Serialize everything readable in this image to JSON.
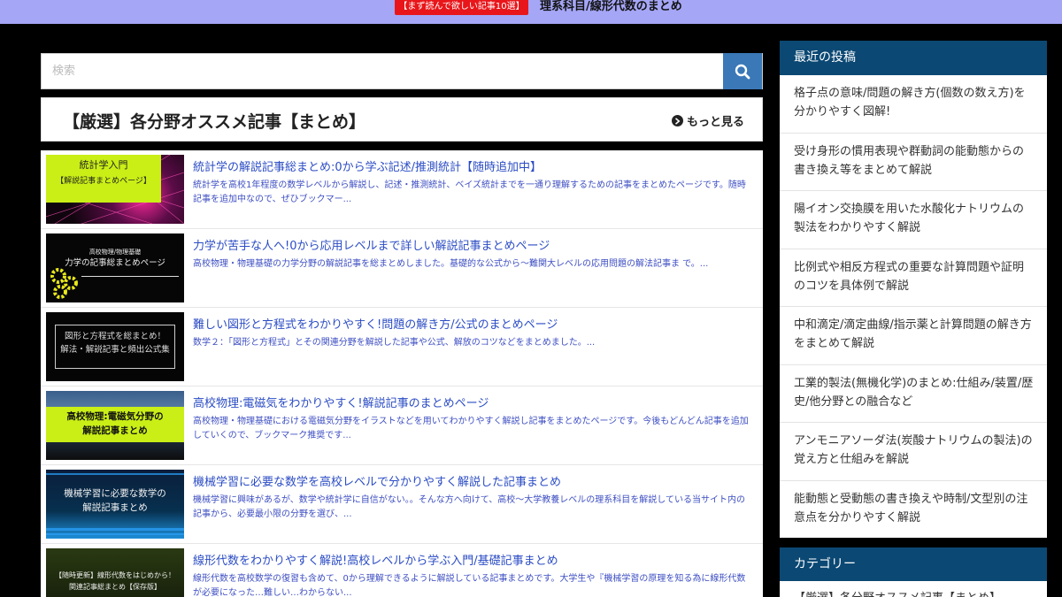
{
  "topbar": {
    "badge": "【まず読んで欲しい記事10選】",
    "link": "理系科目/線形代数のまとめ"
  },
  "search": {
    "placeholder": "検索",
    "value": ""
  },
  "featured": {
    "title": "【厳選】各分野オススメ記事【まとめ】",
    "more": "もっと見る"
  },
  "articles": [
    {
      "title": "統計学の解説記事総まとめ:0から学ぶ記述/推測統計【随時追加中】",
      "excerpt": "統計学を高校1年程度の数学レベルから解説し、記述・推測統計、ベイズ統計までを一通り理解するための記事をまとめたページです。随時記事を追加中なので、ぜひブックマー...",
      "thumb_lines": [
        "統計学入門",
        "【解説記事まとめページ】"
      ]
    },
    {
      "title": "力学が苦手な人へ!0から応用レベルまで詳しい解説記事まとめページ",
      "excerpt": "高校物理・物理基礎の力学分野の解説記事を総まとめしました。基礎的な公式から〜難関大レベルの応用問題の解法記事ま で。...",
      "thumb_lines": [
        "高校物理/物理基礎",
        "力学の記事総まとめページ"
      ]
    },
    {
      "title": "難しい図形と方程式をわかりやすく!問題の解き方/公式のまとめページ",
      "excerpt": "数学２：「図形と方程式」とその関連分野を解説した記事や公式、解放のコツなどをまとめました。...",
      "thumb_lines": [
        "図形と方程式を総まとめ！",
        "解法・解説記事と頻出公式集"
      ]
    },
    {
      "title": "高校物理:電磁気をわかりやすく!解説記事のまとめページ",
      "excerpt": "高校物理・物理基礎における電磁気分野をイラストなどを用いてわかりやすく解説し記事をまとめたページです。今後もどんどん記事を追加していくので、ブックマーク推奨です...",
      "thumb_lines": [
        "高校物理:電磁気分野の",
        "解説記事まとめ"
      ]
    },
    {
      "title": "機械学習に必要な数学を高校レベルで分かりやすく解説した記事まとめ",
      "excerpt": "機械学習に興味があるが、数学や統計学に自信がない。。そんな方へ向けて、高校〜大学教養レベルの理系科目を解説している当サイト内の記事から、必要最小限の分野を選び、...",
      "thumb_lines": [
        "機械学習に必要な数学の",
        "解説記事まとめ"
      ]
    },
    {
      "title": "線形代数をわかりやすく解説!高校レベルから学ぶ入門/基礎記事まとめ",
      "excerpt": "線形代数を高校数学の復習も含めて、0から理解できるように解説している記事まとめです。大学生や『機械学習の原理を知る為に線形代数が必要になった…難しい…わからない...",
      "thumb_lines": [
        "【随時更新】線形代数をはじめから！",
        "関連記事総まとめ【保存版】"
      ]
    }
  ],
  "sidebar": {
    "recent_heading": "最近の投稿",
    "recent": [
      "格子点の意味/問題の解き方(個数の数え方)を分かりやすく図解!",
      "受け身形の慣用表現や群動詞の能動態からの書き換え等をまとめて解説",
      "陽イオン交換膜を用いた水酸化ナトリウムの製法をわかりやすく解説",
      "比例式や相反方程式の重要な計算問題や証明のコツを具体例で解説",
      "中和滴定/滴定曲線/指示薬と計算問題の解き方をまとめて解説",
      "工業的製法(無機化学)のまとめ:仕組み/装置/歴史/他分野との融合など",
      "アンモニアソーダ法(炭酸ナトリウムの製法)の覚え方と仕組みを解説",
      "能動態と受動態の書き換えや時制/文型別の注意点を分かりやすく解説"
    ],
    "category_heading": "カテゴリー",
    "category_first": "【厳選】各分野オススメ記事【まとめ】"
  },
  "colors": {
    "topbar": "#a5a6f6",
    "badge": "#e8161a",
    "search_button": "#3a78b7",
    "sidebar_heading": "#0b4873",
    "link": "#2b4cc4"
  },
  "icons": {
    "search": "magnifier-icon",
    "more": "chevron-circle-right-icon"
  }
}
